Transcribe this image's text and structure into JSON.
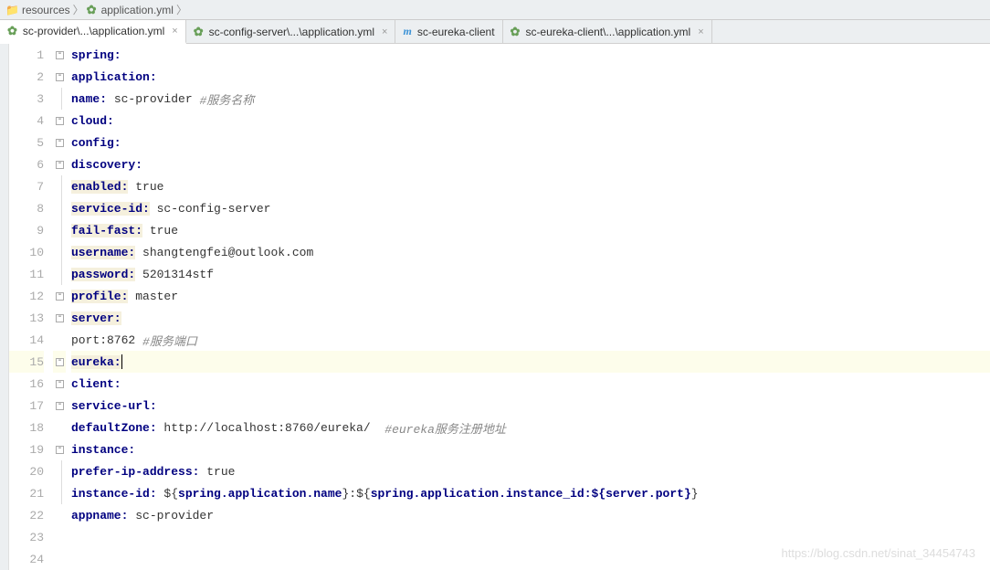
{
  "breadcrumb": {
    "item1": "resources",
    "item2": "application.yml"
  },
  "tabs": {
    "t0": "sc-provider\\...\\application.yml",
    "t1": "sc-config-server\\...\\application.yml",
    "t2": "sc-eureka-client",
    "t3": "sc-eureka-client\\...\\application.yml"
  },
  "lines": {
    "n1": "1",
    "n2": "2",
    "n3": "3",
    "n4": "4",
    "n5": "5",
    "n6": "6",
    "n7": "7",
    "n8": "8",
    "n9": "9",
    "n10": "10",
    "n11": "11",
    "n12": "12",
    "n13": "13",
    "n14": "14",
    "n15": "15",
    "n16": "16",
    "n17": "17",
    "n18": "18",
    "n19": "19",
    "n20": "20",
    "n21": "21",
    "n22": "22",
    "n23": "23",
    "n24": "24"
  },
  "code": {
    "l1_k": "spring:",
    "l2_k": "application:",
    "l3_k": "name:",
    "l3_v": " sc-provider ",
    "l3_c": "#服务名称",
    "l4_k": "cloud:",
    "l5_k": "config:",
    "l6_k": "discovery:",
    "l7_k": "enabled:",
    "l7_v": " true",
    "l8_k": "service-id:",
    "l8_v": " sc-config-server",
    "l9_k": "fail-fast:",
    "l9_v": " true",
    "l10_k": "username:",
    "l10_v": " shangtengfei@outlook.com",
    "l11_k": "password:",
    "l11_v": " 5201314stf",
    "l12_k": "profile:",
    "l12_v": " master",
    "l13_k": "server:",
    "l14_v": "port:8762 ",
    "l14_c": "#服务端口",
    "l15_k": "eureka:",
    "l16_k": "client:",
    "l17_k": "service-url:",
    "l18_k": "defaultZone:",
    "l18_v": " http://localhost:8760/eureka/  ",
    "l18_c": "#eureka服务注册地址",
    "l19_k": "instance:",
    "l20_k": "prefer-ip-address:",
    "l20_v": " true",
    "l21_k": "instance-id:",
    "l21_v1": " ${",
    "l21_k2": "spring.application.name",
    "l21_v2": "}:${",
    "l21_k3": "spring.application.instance_id:${server.port}",
    "l21_v3": "}",
    "l22_k": "appname:",
    "l22_v": " sc-provider"
  },
  "watermark": "https://blog.csdn.net/sinat_34454743"
}
